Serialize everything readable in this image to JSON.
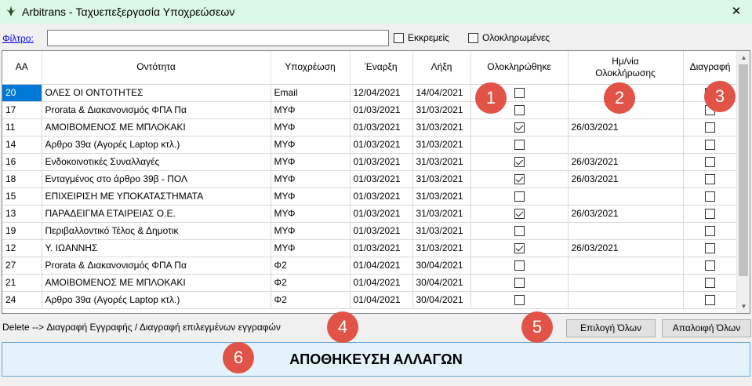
{
  "window": {
    "title": "Arbitrans - Ταχυεπεξεργασία Υποχρεώσεων",
    "close_glyph": "✕"
  },
  "filter": {
    "label": "Φίλτρο:",
    "value": "",
    "pending_label": "Εκκρεμείς",
    "pending_checked": false,
    "completed_label": "Ολοκληρωμένες",
    "completed_checked": false
  },
  "table": {
    "columns": [
      "ΑΑ",
      "Οντότητα",
      "Υποχρέωση",
      "Έναρξη",
      "Λήξη",
      "Ολοκληρώθηκε",
      "Ημ/νία\nΟλοκλήρωσης",
      "Διαγραφή"
    ],
    "rows": [
      {
        "aa": "20",
        "entity": "ΟΛΕΣ ΟΙ ΟΝΤΟΤΗΤΕΣ",
        "obligation": "Email",
        "start": "12/04/2021",
        "end": "14/04/2021",
        "done": false,
        "done_date": "",
        "delete": false
      },
      {
        "aa": "17",
        "entity": "Prorata & Διακανονισμός ΦΠΑ Πα",
        "obligation": "ΜΥΦ",
        "start": "01/03/2021",
        "end": "31/03/2021",
        "done": false,
        "done_date": "",
        "delete": false
      },
      {
        "aa": "11",
        "entity": "ΑΜΟΙΒΟΜΕΝΟΣ ΜΕ ΜΠΛΟΚΑΚΙ",
        "obligation": "ΜΥΦ",
        "start": "01/03/2021",
        "end": "31/03/2021",
        "done": true,
        "done_date": "26/03/2021",
        "delete": false
      },
      {
        "aa": "14",
        "entity": "Αρθρο 39α (Αγορές Laptop κτλ.)",
        "obligation": "ΜΥΦ",
        "start": "01/03/2021",
        "end": "31/03/2021",
        "done": false,
        "done_date": "",
        "delete": false
      },
      {
        "aa": "16",
        "entity": "Ενδοκοινοτικές Συναλλαγές",
        "obligation": "ΜΥΦ",
        "start": "01/03/2021",
        "end": "31/03/2021",
        "done": true,
        "done_date": "26/03/2021",
        "delete": false
      },
      {
        "aa": "18",
        "entity": "Ενταγμένος στο άρθρο 39β - ΠΟΛ",
        "obligation": "ΜΥΦ",
        "start": "01/03/2021",
        "end": "31/03/2021",
        "done": true,
        "done_date": "26/03/2021",
        "delete": false
      },
      {
        "aa": "15",
        "entity": "ΕΠΙΧΕΙΡΙΣΗ ΜΕ ΥΠΟΚΑΤΑΣΤΗΜΑΤΑ",
        "obligation": "ΜΥΦ",
        "start": "01/03/2021",
        "end": "31/03/2021",
        "done": false,
        "done_date": "",
        "delete": false
      },
      {
        "aa": "13",
        "entity": "ΠΑΡΑΔΕΙΓΜΑ ΕΤΑΙΡΕΙΑΣ Ο.Ε.",
        "obligation": "ΜΥΦ",
        "start": "01/03/2021",
        "end": "31/03/2021",
        "done": true,
        "done_date": "26/03/2021",
        "delete": false
      },
      {
        "aa": "19",
        "entity": "Περιβαλλοντικό Τέλος & Δημοτικ",
        "obligation": "ΜΥΦ",
        "start": "01/03/2021",
        "end": "31/03/2021",
        "done": false,
        "done_date": "",
        "delete": false
      },
      {
        "aa": "12",
        "entity": "Υ. ΙΩΑΝΝΗΣ",
        "obligation": "ΜΥΦ",
        "start": "01/03/2021",
        "end": "31/03/2021",
        "done": true,
        "done_date": "26/03/2021",
        "delete": false
      },
      {
        "aa": "27",
        "entity": "Prorata & Διακανονισμός ΦΠΑ Πα",
        "obligation": "Φ2",
        "start": "01/04/2021",
        "end": "30/04/2021",
        "done": false,
        "done_date": "",
        "delete": false
      },
      {
        "aa": "21",
        "entity": "ΑΜΟΙΒΟΜΕΝΟΣ ΜΕ ΜΠΛΟΚΑΚΙ",
        "obligation": "Φ2",
        "start": "01/04/2021",
        "end": "30/04/2021",
        "done": false,
        "done_date": "",
        "delete": false
      },
      {
        "aa": "24",
        "entity": "Αρθρο 39α (Αγορές Laptop κτλ.)",
        "obligation": "Φ2",
        "start": "01/04/2021",
        "end": "30/04/2021",
        "done": false,
        "done_date": "",
        "delete": false
      }
    ]
  },
  "footer": {
    "hint": "Delete --> Διαγραφή Εγγραφής / Διαγραφή επιλεγμένων εγγραφών",
    "select_all": "Επιλογή Όλων",
    "clear_all": "Απαλοιφή Όλων",
    "save": "ΑΠΟΘΗΚΕΥΣΗ ΑΛΛΑΓΩΝ"
  },
  "markers": [
    "1",
    "2",
    "3",
    "4",
    "5",
    "6"
  ],
  "colors": {
    "marker": "#e25347",
    "titlebar": "#dcf8e6",
    "selection": "#0078d7",
    "link": "#0000ee"
  }
}
